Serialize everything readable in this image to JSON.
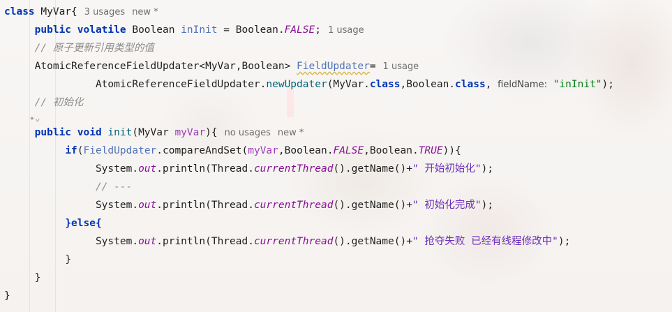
{
  "code": {
    "line1": {
      "class_kw": "class",
      "class_name": "MyVar{",
      "hint_usages": "3 usages",
      "hint_new": "new *"
    },
    "line2": {
      "mods": "public volatile",
      "type": "Boolean",
      "name": "inInit",
      "eq": " = Boolean.",
      "const": "FALSE",
      "semi": ";",
      "hint": "1 usage"
    },
    "line3": {
      "comment": "// 原子更新引用类型的值"
    },
    "line4": {
      "type": "AtomicReferenceFieldUpdater<MyVar,Boolean>",
      "name": "FieldUpdater",
      "eq": "=",
      "hint": "1 usage"
    },
    "line5": {
      "prefix": "AtomicReferenceFieldUpdater.",
      "method": "newUpdater",
      "args1": "(MyVar.",
      "class1": "class",
      "args2": ",Boolean.",
      "class2": "class",
      "comma": ",",
      "param_hint": "fieldName:",
      "str": "\"inInit\"",
      "end": ");"
    },
    "line6": {
      "comment": "// 初始化"
    },
    "line7": {
      "mods": "public void",
      "method": "init",
      "sig1": "(MyVar ",
      "param": "myVar",
      "sig2": "){",
      "hint_usages": "no usages",
      "hint_new": "new *"
    },
    "line8": {
      "if": "if",
      "open": "(",
      "field": "FieldUpdater",
      "call": ".compareAndSet(",
      "param": "myVar",
      "a1": ",Boolean.",
      "c1": "FALSE",
      "a2": ",Boolean.",
      "c2": "TRUE",
      "end": ")){"
    },
    "line9": {
      "sys": "System.",
      "out": "out",
      "mid": ".println(Thread.",
      "ct": "currentThread",
      "rest": "().getName()+",
      "str": "\" 开始初始化\"",
      "end": ");"
    },
    "line10": {
      "comment": "// ---"
    },
    "line11": {
      "sys": "System.",
      "out": "out",
      "mid": ".println(Thread.",
      "ct": "currentThread",
      "rest": "().getName()+",
      "str": "\" 初始化完成\"",
      "end": ");"
    },
    "line12": {
      "text": "}else{"
    },
    "line13": {
      "sys": "System.",
      "out": "out",
      "mid": ".println(Thread.",
      "ct": "currentThread",
      "rest": "().getName()+",
      "str": "\" 抢夺失败 已经有线程修改中\"",
      "end": ");"
    },
    "line14": {
      "text": "}"
    },
    "line15": {
      "text": "}"
    },
    "line16": {
      "text": "}"
    }
  },
  "ai_icon": "ai-assistant-icon",
  "colors": {
    "keyword": "#0033b3",
    "field": "#871094",
    "method": "#00627a",
    "comment": "#8c8c8c",
    "string": "#067d17"
  }
}
